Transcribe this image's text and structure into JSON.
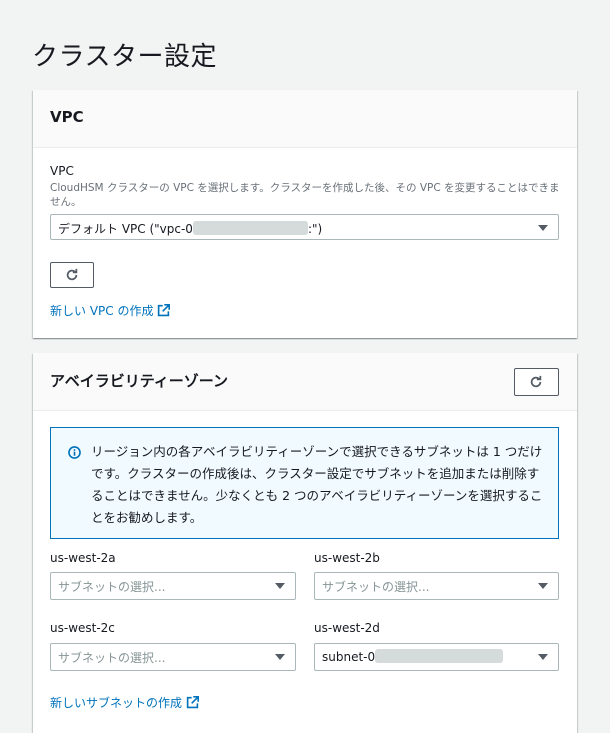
{
  "page": {
    "title": "クラスター設定"
  },
  "vpc_panel": {
    "title": "VPC",
    "field_label": "VPC",
    "description": "CloudHSM クラスターの VPC を選択します。クラスターを作成した後、その VPC を変更することはできません。",
    "select_prefix": "デフォルト VPC (\"vpc-0",
    "select_suffix": ":\")",
    "new_vpc_link": "新しい VPC の作成",
    "icons": {
      "refresh": "refresh-icon",
      "external": "external-link-icon"
    }
  },
  "az_panel": {
    "title": "アベイラビリティーゾーン",
    "info_text": "リージョン内の各アベイラビリティーゾーンで選択できるサブネットは 1 つだけです。クラスターの作成後は、クラスター設定でサブネットを追加または削除することはできません。少なくとも 2 つのアベイラビリティーゾーンを選択することをお勧めします。",
    "zones": [
      {
        "label": "us-west-2a",
        "placeholder": "サブネットの選択..."
      },
      {
        "label": "us-west-2b",
        "placeholder": "サブネットの選択..."
      },
      {
        "label": "us-west-2c",
        "placeholder": "サブネットの選択..."
      },
      {
        "label": "us-west-2d",
        "value": "subnet-0"
      }
    ],
    "new_subnet_link": "新しいサブネットの作成"
  },
  "colors": {
    "link": "#0073bb",
    "info_border": "#0073bb",
    "info_bg": "#f1faff"
  }
}
